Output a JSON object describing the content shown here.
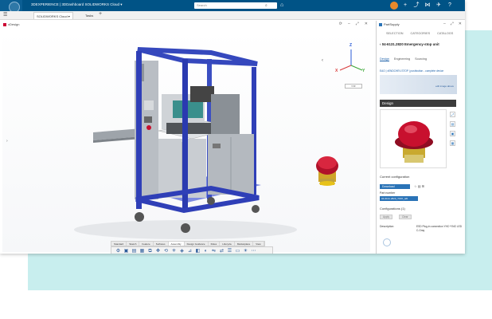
{
  "topbar": {
    "brand": "3DEXPERIENCE | 3DDashboard  SOLIDWORKS Cloud ▾",
    "search_placeholder": "Search",
    "search_icon": "search-icon",
    "tag_icon": "tag-icon",
    "icons": [
      "avatar",
      "add-icon",
      "share-icon",
      "network-icon",
      "compass-icon",
      "help-icon"
    ]
  },
  "tabs": {
    "items": [
      {
        "label": "SOLIDWORKS Cloud ▾"
      },
      {
        "label": "Tasks"
      }
    ],
    "add_label": "+"
  },
  "design_panel": {
    "title": "xDesign",
    "view_select": "▾ ▾▾",
    "triad": {
      "x": "X",
      "y": "Y",
      "z": "Z"
    }
  },
  "action_bar": {
    "tabs": [
      "Standard",
      "Sketch",
      "Feature",
      "Surfaces",
      "Assembly",
      "Design Guidance",
      "Rules",
      "Lifecycle",
      "Marketplace",
      "View"
    ],
    "active_tab": "Assembly"
  },
  "part_panel": {
    "app_name": "PartSupply",
    "nav": [
      "SELECTION",
      "CATEGORIES",
      "CATALOGS"
    ],
    "title": "04-6131.2820 Emergency-stop unit",
    "subtabs": [
      "Design",
      "Engineering",
      "Sourcing"
    ],
    "link": "EAO | xENDCHEV-STOP | pushbutton - complete device",
    "banner_text": "edit image above",
    "section": "Design",
    "current_config": "Current configuration",
    "download": "Download",
    "part_number_label": "Part number",
    "part_number": "04-6131.2820_TK87_I20",
    "configurations": "Configurations (1)",
    "apply": "Apply",
    "clear": "Clear",
    "description_label": "Description",
    "description_value": "ESD Plug-in connection YHC+YNO LED C-Gray"
  },
  "colors": {
    "topbar": "#005386",
    "accent": "#2a73b7",
    "frame_blue": "#2f3fb7",
    "estop_red": "#c8102e",
    "estop_yellow": "#e7c21a",
    "bg_card": "#c8eeee"
  }
}
